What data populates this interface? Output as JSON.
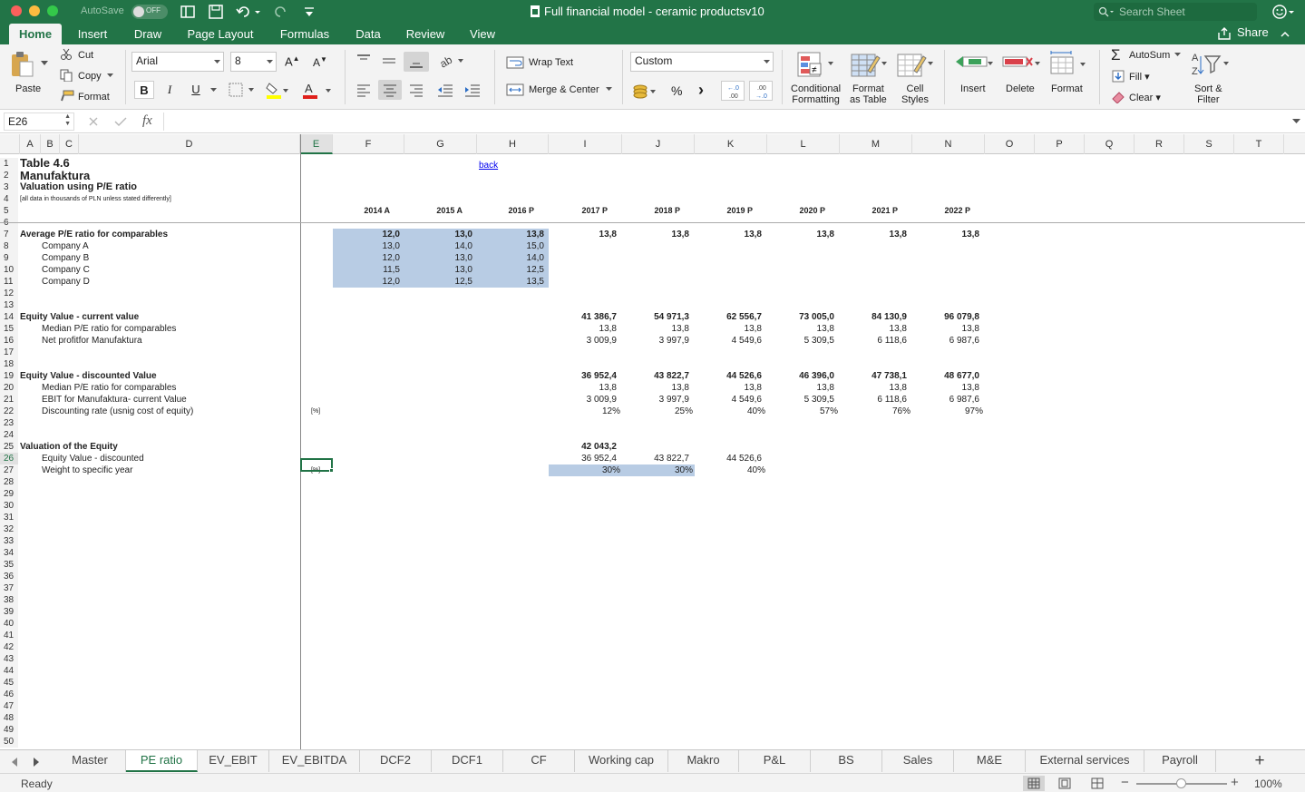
{
  "window": {
    "title": "Full financial model - ceramic productsv10",
    "autosave": "AutoSave",
    "autosave_state": "OFF",
    "search_placeholder": "Search Sheet"
  },
  "ribbon_tabs": [
    "Home",
    "Insert",
    "Draw",
    "Page Layout",
    "Formulas",
    "Data",
    "Review",
    "View"
  ],
  "share": "Share",
  "ribbon": {
    "paste": "Paste",
    "cut": "Cut",
    "copy": "Copy",
    "format_painter": "Format",
    "font": "Arial",
    "size": "8",
    "bold": "B",
    "italic": "I",
    "underline": "U",
    "wrap_text": "Wrap Text",
    "merge_center": "Merge & Center",
    "number_format": "Custom",
    "percent": "%",
    "comma": "›",
    "inc_dec": ".0\n.00",
    "dec_dec": ".00\n.0",
    "cond_format": [
      "Conditional",
      "Formatting"
    ],
    "format_table": [
      "Format",
      "as Table"
    ],
    "cell_styles": [
      "Cell",
      "Styles"
    ],
    "insert": "Insert",
    "delete": "Delete",
    "format": "Format",
    "autosum": "AutoSum",
    "fill": "Fill",
    "clear": "Clear",
    "sort_filter": [
      "Sort &",
      "Filter"
    ]
  },
  "formula_bar": {
    "name_box": "E26",
    "fx": "fx",
    "value": ""
  },
  "columns": [
    "A",
    "B",
    "C",
    "D",
    "E",
    "F",
    "G",
    "H",
    "I",
    "J",
    "K",
    "L",
    "M",
    "N",
    "O",
    "P",
    "Q",
    "R",
    "S",
    "T"
  ],
  "row_numbers": [
    "1",
    "2",
    "3",
    "4",
    "5",
    "6",
    "7",
    "8",
    "9",
    "10",
    "11",
    "12",
    "13",
    "14",
    "15",
    "16",
    "17",
    "18",
    "19",
    "20",
    "21",
    "22",
    "23",
    "24",
    "25",
    "26",
    "27",
    "28",
    "29",
    "30",
    "31",
    "32",
    "33",
    "34",
    "35",
    "36",
    "37",
    "38",
    "39",
    "40",
    "41",
    "42",
    "43",
    "44",
    "45",
    "46",
    "47",
    "48",
    "49",
    "50"
  ],
  "selected_row": "26",
  "selected_col": "E",
  "sheet": {
    "title": "Table 4.6",
    "company": "Manufaktura",
    "subtitle": "Valuation using P/E ratio",
    "note": "[all data in thousands of PLN unless stated differently]",
    "back_link": "back",
    "years": [
      "2014 A",
      "2015 A",
      "2016 P",
      "2017 P",
      "2018 P",
      "2019 P",
      "2020 P",
      "2021 P",
      "2022 P"
    ],
    "avg_pe_label": "Average P/E ratio for comparables",
    "avg_pe": [
      "12,0",
      "13,0",
      "13,8",
      "13,8",
      "13,8",
      "13,8",
      "13,8",
      "13,8",
      "13,8"
    ],
    "companies": [
      {
        "name": "Company A",
        "values": [
          "13,0",
          "14,0",
          "15,0"
        ]
      },
      {
        "name": "Company B",
        "values": [
          "12,0",
          "13,0",
          "14,0"
        ]
      },
      {
        "name": "Company C",
        "values": [
          "11,5",
          "13,0",
          "12,5"
        ]
      },
      {
        "name": "Company D",
        "values": [
          "12,0",
          "12,5",
          "13,5"
        ]
      }
    ],
    "ev_current": {
      "label": "Equity Value - current value",
      "values": [
        "41 386,7",
        "54 971,3",
        "62 556,7",
        "73 005,0",
        "84 130,9",
        "96 079,8"
      ]
    },
    "ev_current_pe": {
      "label": "Median P/E ratio for comparables",
      "values": [
        "13,8",
        "13,8",
        "13,8",
        "13,8",
        "13,8",
        "13,8"
      ]
    },
    "ev_current_np": {
      "label": "Net profitfor Manufaktura",
      "values": [
        "3 009,9",
        "3 997,9",
        "4 549,6",
        "5 309,5",
        "6 118,6",
        "6 987,6"
      ]
    },
    "ev_disc": {
      "label": "Equity Value - discounted Value",
      "values": [
        "36 952,4",
        "43 822,7",
        "44 526,6",
        "46 396,0",
        "47 738,1",
        "48 677,0"
      ]
    },
    "ev_disc_pe": {
      "label": "Median P/E ratio for comparables",
      "values": [
        "13,8",
        "13,8",
        "13,8",
        "13,8",
        "13,8",
        "13,8"
      ]
    },
    "ev_disc_ebit": {
      "label": "EBIT for Manufaktura- current Value",
      "values": [
        "3 009,9",
        "3 997,9",
        "4 549,6",
        "5 309,5",
        "6 118,6",
        "6 987,6"
      ]
    },
    "ev_disc_rate": {
      "label": "Discounting rate (usnig cost of equity)",
      "unit": "[%]",
      "values": [
        "12%",
        "25%",
        "40%",
        "57%",
        "76%",
        "97%"
      ]
    },
    "valuation": {
      "label": "Valuation of the Equity",
      "total": "42 043,2"
    },
    "val_ev": {
      "label": "Equity Value - discounted",
      "values": [
        "36 952,4",
        "43 822,7",
        "44 526,6"
      ]
    },
    "val_weight": {
      "label": "Weight to specific year",
      "unit": "[%]",
      "values": [
        "30%",
        "30%",
        "40%"
      ]
    }
  },
  "sheet_tabs": [
    "Master",
    "PE ratio",
    "EV_EBIT",
    "EV_EBITDA",
    "DCF2",
    "DCF1",
    "CF",
    "Working cap",
    "Makro",
    "P&L",
    "BS",
    "Sales",
    "M&E",
    "External services",
    "Payroll"
  ],
  "active_sheet": "PE ratio",
  "status": {
    "ready": "Ready",
    "zoom": "100%"
  },
  "colors": {
    "excel_green": "#227447",
    "input_blue": "#b8cce4",
    "link": "#0000ee"
  }
}
